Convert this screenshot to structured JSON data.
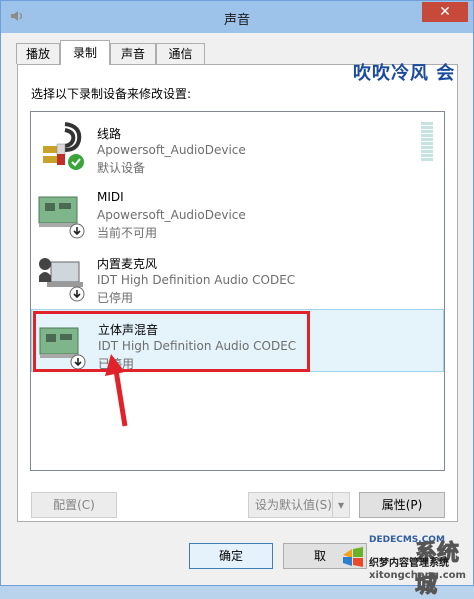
{
  "window": {
    "title": "声音",
    "close_symbol": "✕"
  },
  "tabs": [
    {
      "label": "播放"
    },
    {
      "label": "录制"
    },
    {
      "label": "声音"
    },
    {
      "label": "通信"
    }
  ],
  "instruction": "选择以下录制设备来修改设置:",
  "overlay_text": "吹吹冷风 会",
  "devices": [
    {
      "name": "线路",
      "driver": "Apowersoft_AudioDevice",
      "status": "默认设备"
    },
    {
      "name": "MIDI",
      "driver": "Apowersoft_AudioDevice",
      "status": "当前不可用"
    },
    {
      "name": "内置麦克风",
      "driver": "IDT High Definition Audio CODEC",
      "status": "已停用"
    },
    {
      "name": "立体声混音",
      "driver": "IDT High Definition Audio CODEC",
      "status": "已停用"
    }
  ],
  "buttons": {
    "configure": "配置(C)",
    "set_default": "设为默认值(S)",
    "properties": "属性(P)",
    "ok": "确定",
    "cancel": "取"
  },
  "watermark": {
    "site1": "DEDECMS.COM",
    "logo_text": "系统城",
    "site2_cn": "织梦内容管理系统",
    "site3": "xitongcheng.com"
  },
  "colors": {
    "highlight": "#e0232b",
    "selection": "#e5f3fb",
    "titlebar": "#9ec3ea"
  }
}
